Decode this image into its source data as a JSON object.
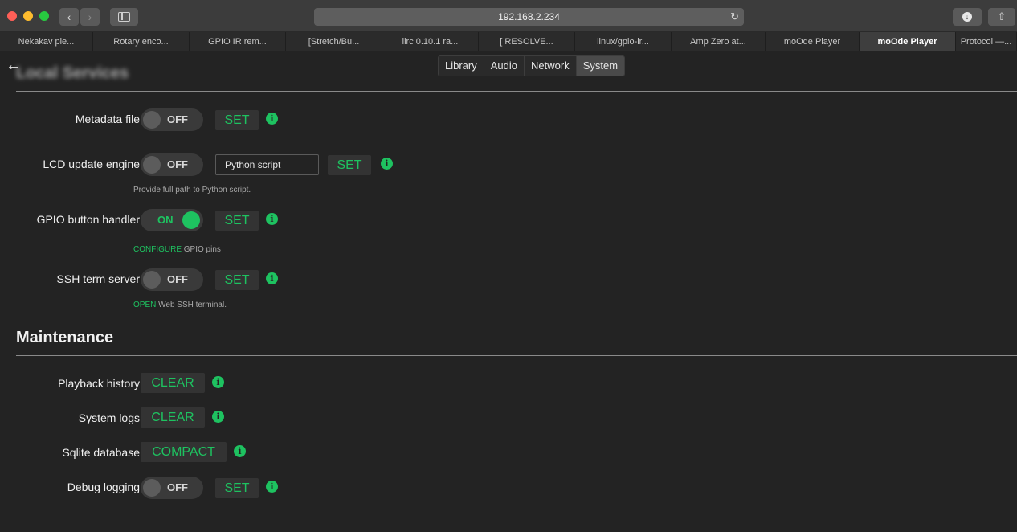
{
  "browser": {
    "url": "192.168.2.234",
    "tabs": [
      {
        "label": "Nekakav ple..."
      },
      {
        "label": "Rotary enco..."
      },
      {
        "label": "GPIO IR rem..."
      },
      {
        "label": "[Stretch/Bu..."
      },
      {
        "label": "lirc 0.10.1 ra..."
      },
      {
        "label": "[ RESOLVE..."
      },
      {
        "label": "linux/gpio-ir..."
      },
      {
        "label": "Amp Zero at..."
      },
      {
        "label": "moOde Player"
      },
      {
        "label": "moOde Player"
      },
      {
        "label": "Protocol —..."
      }
    ],
    "active_tab_index": 9
  },
  "header": {
    "back_icon": "arrow-left-icon",
    "section_title_obscured": "Local Services",
    "nav_tabs": [
      {
        "label": "Library"
      },
      {
        "label": "Audio"
      },
      {
        "label": "Network"
      },
      {
        "label": "System"
      }
    ],
    "active_nav": "System"
  },
  "local_services": {
    "metadata_file": {
      "label": "Metadata file",
      "state": "OFF",
      "button": "SET"
    },
    "lcd_update_engine": {
      "label": "LCD update engine",
      "state": "OFF",
      "input_value": "Python script",
      "button": "SET",
      "help": "Provide full path to Python script."
    },
    "gpio_button_handler": {
      "label": "GPIO button handler",
      "state": "ON",
      "button": "SET",
      "help_link": "CONFIGURE",
      "help_rest": " GPIO pins"
    },
    "ssh_term_server": {
      "label": "SSH term server",
      "state": "OFF",
      "button": "SET",
      "help_link": "OPEN",
      "help_rest": " Web SSH terminal."
    }
  },
  "maintenance": {
    "title": "Maintenance",
    "playback_history": {
      "label": "Playback history",
      "button": "CLEAR"
    },
    "system_logs": {
      "label": "System logs",
      "button": "CLEAR"
    },
    "sqlite_database": {
      "label": "Sqlite database",
      "button": "COMPACT"
    },
    "debug_logging": {
      "label": "Debug logging",
      "state": "OFF",
      "button": "SET"
    }
  },
  "info_glyph": "i",
  "colors": {
    "accent": "#1ec260",
    "background": "#232323"
  }
}
